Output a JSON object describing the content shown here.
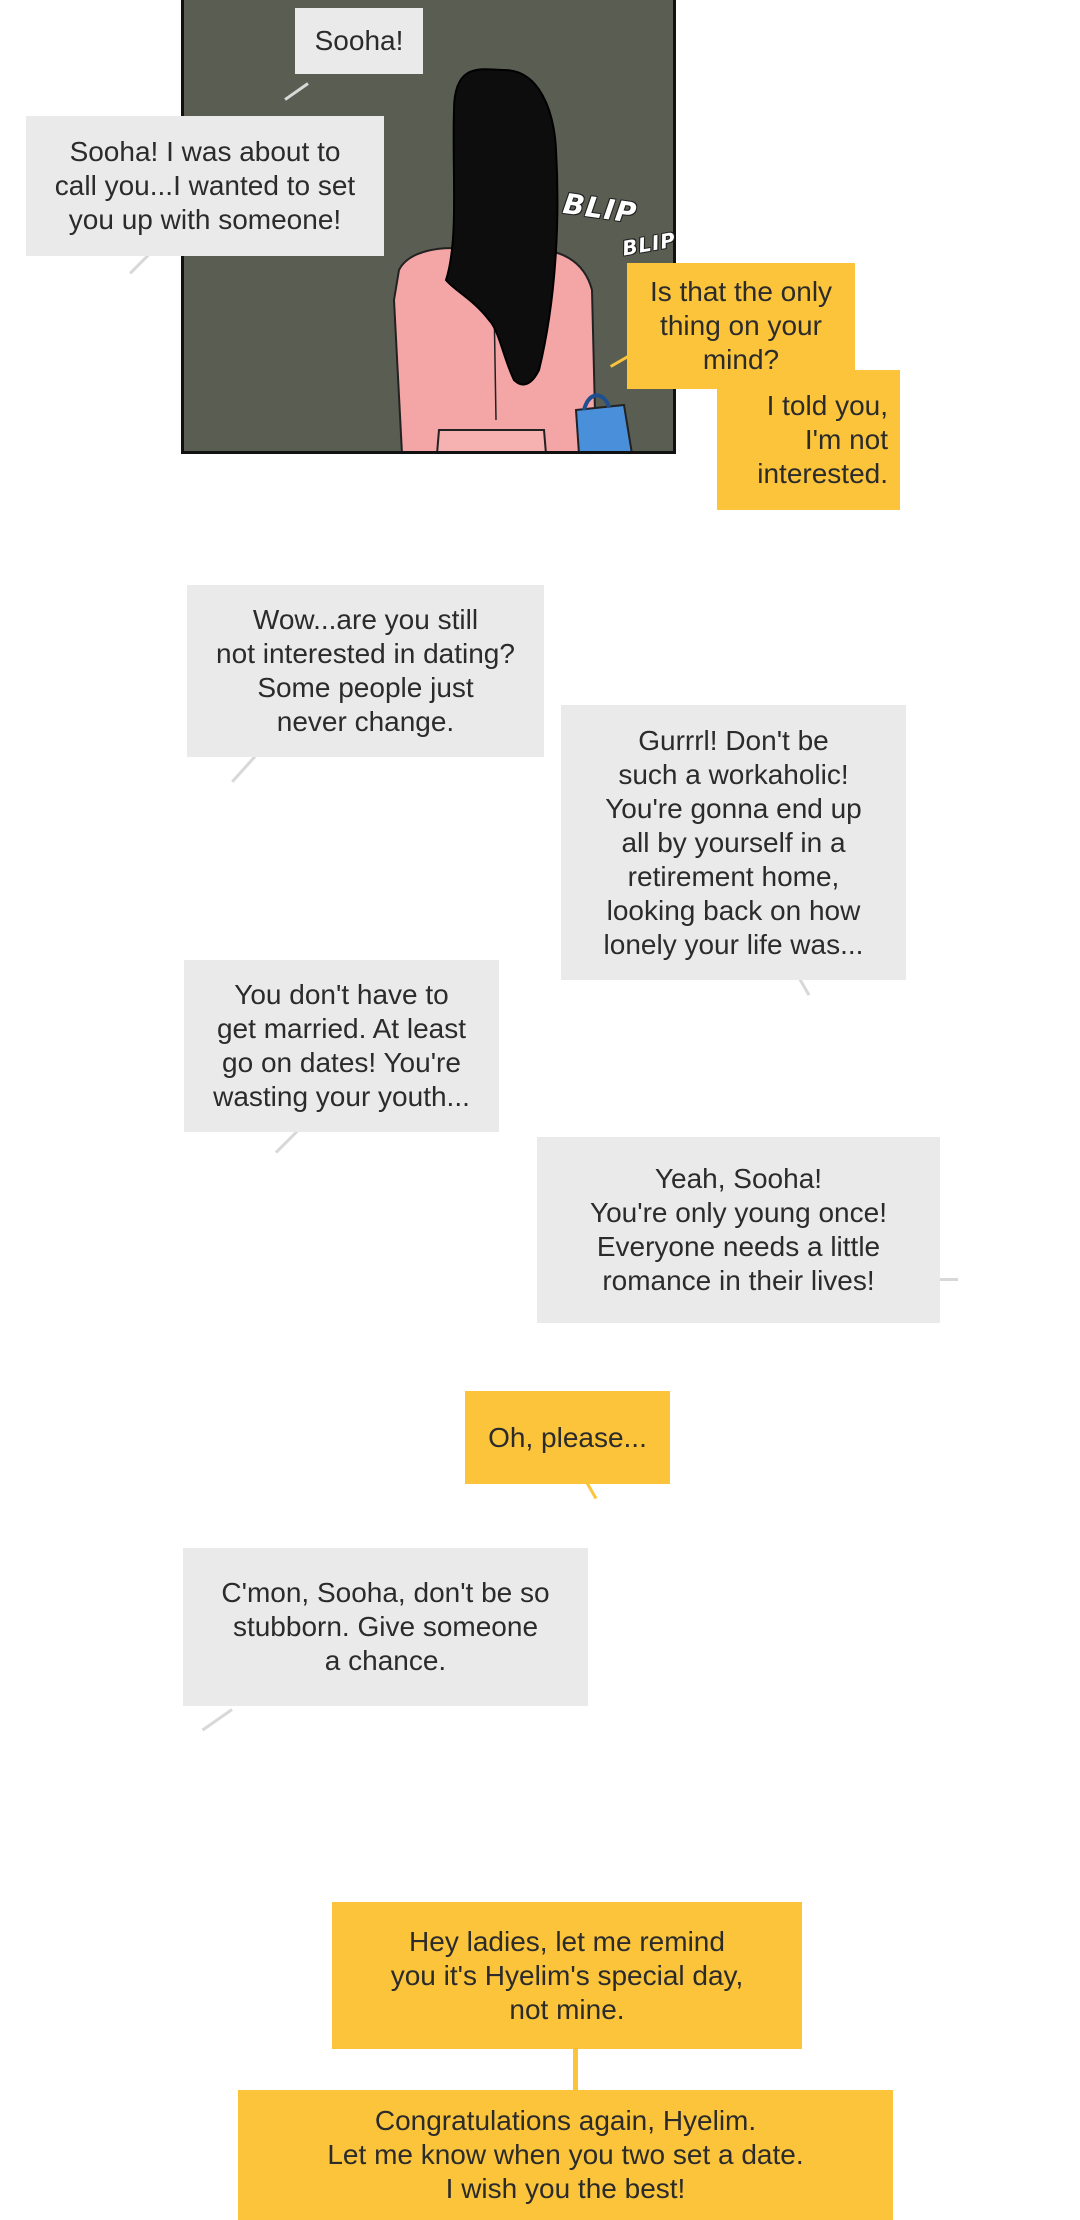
{
  "comic": {
    "sfx": [
      "BLIP",
      "BLIP"
    ],
    "bubbles": [
      {
        "id": "b1",
        "style": "gray",
        "text": "Sooha!"
      },
      {
        "id": "b2",
        "style": "gray",
        "text": "Sooha! I was about to\ncall you...I wanted to set\nyou up with someone!"
      },
      {
        "id": "b3",
        "style": "yellow",
        "text": "Is that the only\nthing on your\nmind?"
      },
      {
        "id": "b4",
        "style": "yellow",
        "text": "I told you,\nI'm not\ninterested."
      },
      {
        "id": "b5",
        "style": "gray",
        "text": "Wow...are you still\nnot interested in dating?\nSome people just\nnever change."
      },
      {
        "id": "b6",
        "style": "gray",
        "text": "Gurrrl! Don't be\nsuch a workaholic!\nYou're gonna end up\nall by yourself in a\nretirement home,\nlooking back on how\nlonely your life was..."
      },
      {
        "id": "b7",
        "style": "gray",
        "text": "You don't have to\nget married. At least\ngo on dates! You're\nwasting your youth..."
      },
      {
        "id": "b8",
        "style": "gray",
        "text": "Yeah, Sooha!\nYou're only young once!\nEveryone needs a little\nromance in their lives!"
      },
      {
        "id": "b9",
        "style": "yellow",
        "text": "Oh, please..."
      },
      {
        "id": "b10",
        "style": "gray",
        "text": "C'mon, Sooha, don't be so\nstubborn. Give someone\na chance."
      },
      {
        "id": "b11",
        "style": "yellow",
        "text": "Hey ladies, let me remind\nyou it's Hyelim's special day,\nnot mine."
      },
      {
        "id": "b12",
        "style": "yellow",
        "text": "Congratulations again, Hyelim.\nLet me know when you two set a date.\nI wish you the best!"
      }
    ]
  }
}
